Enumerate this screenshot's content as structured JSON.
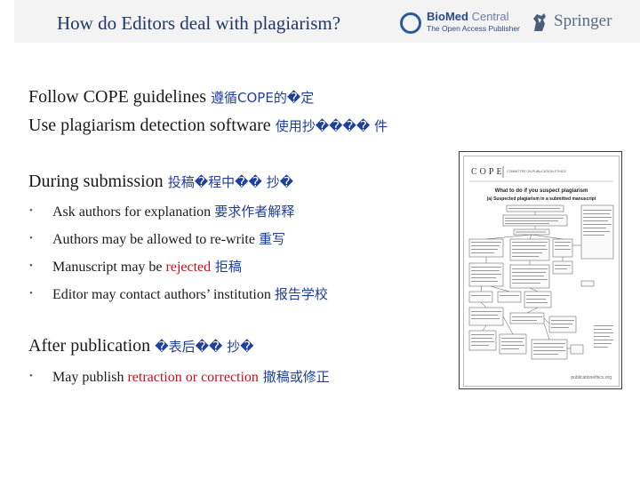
{
  "header": {
    "title": "How do Editors deal with plagiarism?",
    "biomed": {
      "name_bold": "BioMed",
      "name_light": "Central",
      "tagline": "The Open Access Publisher"
    },
    "springer": {
      "name": "Springer"
    }
  },
  "cope_section": {
    "line1": {
      "en": "Follow COPE guidelines ",
      "cn": "遵循COPE的�定"
    },
    "line2": {
      "en": "Use plagiarism detection software ",
      "cn": "使用抄���� 件"
    }
  },
  "submission": {
    "heading": {
      "en": "During submission ",
      "cn": "投稿�程中�� 抄�"
    },
    "bullets": [
      {
        "en": "Ask authors for explanation ",
        "cn": "要求作者解释"
      },
      {
        "en": "Authors may be allowed to re-write ",
        "cn": "重写"
      },
      {
        "en": "Manuscript may be ",
        "red": "rejected",
        "cn": " 拒稿"
      },
      {
        "en": "Editor may contact authors’ institution ",
        "cn": "报告学校"
      }
    ]
  },
  "publication": {
    "heading": {
      "en": "After publication ",
      "cn": "�表后�� 抄�"
    },
    "bullets": [
      {
        "en": "May publish ",
        "red": "retraction or correction",
        "cn": " 撤稿或修正"
      }
    ]
  },
  "poster": {
    "logo": "COPE",
    "org": "COMMITTEE ON PUBLICATION ETHICS",
    "title_line1": "What to do if you suspect plagiarism",
    "title_line2": "(a) Suspected plagiarism in a submitted manuscript",
    "footer": "publicationethics.org"
  },
  "colors": {
    "title": "#1f3864",
    "chinese": "#1f3f9f",
    "emphasis": "#c0141b"
  }
}
